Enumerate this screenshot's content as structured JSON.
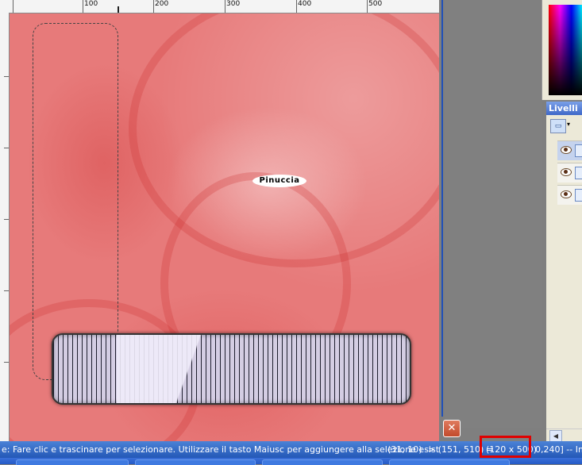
{
  "ruler": {
    "labels": [
      "100",
      "200",
      "300",
      "400",
      "500"
    ]
  },
  "canvas": {
    "badge_text": "Pinuccia"
  },
  "panels": {
    "layers_title": "Livelli",
    "layers_dropdown": "▾"
  },
  "close_label": "✕",
  "status": {
    "hint": "e: Fare clic e trascinare per selezionare. Utilizzare il tasto Maiusc per aggiungere alla selezione esist",
    "coords": "(31, 10) -> (151, 510) =",
    "size": "(120 x 500)",
    "tail": "0,240] -- Im"
  },
  "colors": {
    "canvas_red": "#e77a7a",
    "highlight": "#e00000",
    "status_blue": "#2458b7"
  }
}
